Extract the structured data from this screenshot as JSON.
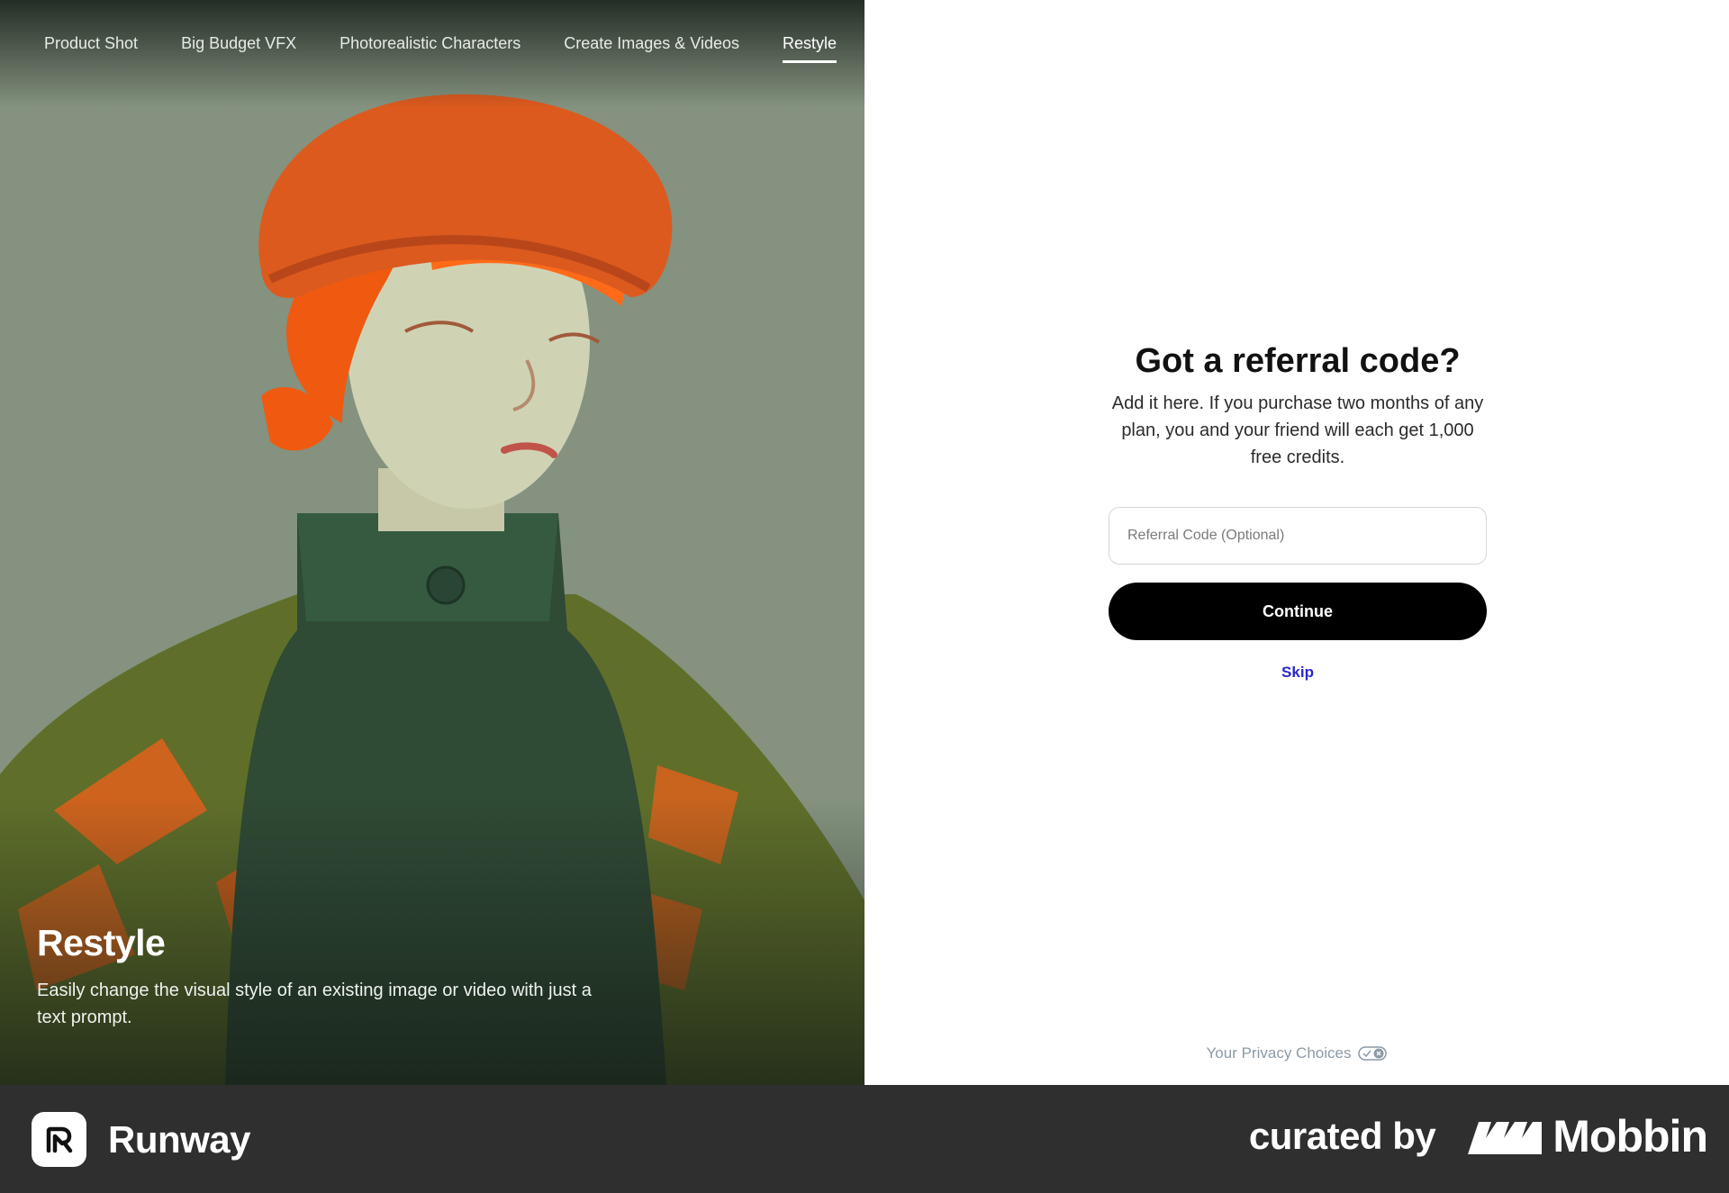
{
  "hero": {
    "tabs": [
      {
        "label": "Product Shot",
        "active": false
      },
      {
        "label": "Big Budget VFX",
        "active": false
      },
      {
        "label": "Photorealistic Characters",
        "active": false
      },
      {
        "label": "Create Images & Videos",
        "active": false
      },
      {
        "label": "Restyle",
        "active": true
      }
    ],
    "title": "Restyle",
    "description": "Easily change the visual style of an existing image or video with just a text prompt."
  },
  "referral": {
    "title": "Got a referral code?",
    "subtitle": "Add it here. If you purchase two months of any plan, you and your friend will each get 1,000 free credits.",
    "input_placeholder": "Referral Code (Optional)",
    "input_value": "",
    "continue_label": "Continue",
    "skip_label": "Skip"
  },
  "privacy": {
    "label": "Your Privacy Choices",
    "icon": "privacy-toggle-icon"
  },
  "footer": {
    "brand_name": "Runway",
    "curated_text": "curated by",
    "curator_name": "Mobbin"
  },
  "colors": {
    "skip_link": "#2a27c6",
    "button_bg": "#000000",
    "footer_bg": "#2f2f2f"
  }
}
